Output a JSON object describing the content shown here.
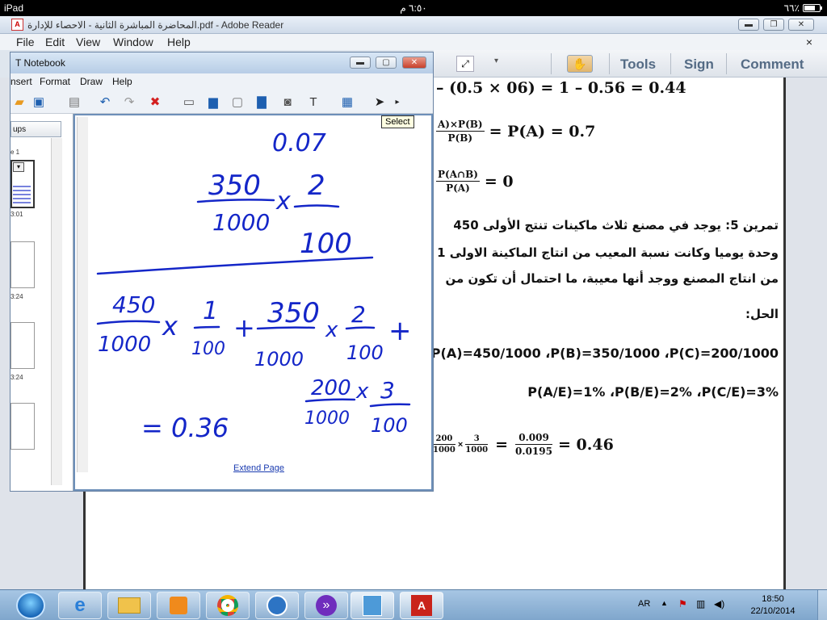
{
  "ipad_status": {
    "device": "iPad",
    "time": "٦:٥٠ م",
    "battery": "٦٦٪"
  },
  "reader": {
    "window_title": "المحاضرة المباشرة الثانية - الاحصاء للإدارة.pdf - Adobe Reader",
    "menu": [
      "File",
      "Edit",
      "View",
      "Window",
      "Help"
    ],
    "close_x": "×",
    "toolbar": {
      "tools": "Tools",
      "sign": "Sign",
      "comment": "Comment"
    }
  },
  "pdf": {
    "line1": "– (0.5 × 06) = 1 – 0.56 = 0.44",
    "line2_frac_num": "A)×P(B)",
    "line2_frac_den": "P(B)",
    "line2_rest": "= P(A) = 0.7",
    "line3_frac_num": "P(A∩B)",
    "line3_frac_den": "P(A)",
    "line3_rest": "= 0",
    "arabic1": "تمرين 5: يوجد في مصنع ثلاث ماكينات تنتج الأولى 450",
    "arabic2": "وحدة يوميا وكانت نسبة المعيب من انتاج الماكينة الاولى 1",
    "arabic3": "من انتاج المصنع ووجد أنها معيبة، ما احتمال أن تكون من",
    "solution": "الحل:",
    "probs": "P(A)=450/1000 ،P(B)=350/1000 ،P(C)=200/1000",
    "cond_probs": "P(A/E)=1%   ،P(B/E)=2% ،P(C/E)=3%",
    "final_f1_num": "200",
    "final_f1_den": "1000",
    "final_x": "×",
    "final_f2_num": "3",
    "final_f2_den": "1000",
    "final_eq1": "=",
    "final_f3_num": "0.009",
    "final_f3_den": "0.0195",
    "final_rest": "= 0.46"
  },
  "notebook": {
    "title": "T Notebook",
    "menu": [
      "nsert",
      "Format",
      "Draw",
      "Help"
    ],
    "tooltip": "Select",
    "groups_button": "ups",
    "thumb_labels": [
      "e 1",
      "3:01",
      "3:24",
      "3:24"
    ],
    "extend_page": "Extend Page",
    "handwriting": {
      "top_value": "0.07",
      "frac_a_num": "350",
      "frac_a_den": "1000",
      "times_a": "x",
      "frac_b_num": "2",
      "frac_b_den": "100",
      "d1_num": "450",
      "d1_den": "1000",
      "d_times1": "x",
      "d2_num": "1",
      "d2_den": "100",
      "plus1": "+",
      "d3_num": "350",
      "d3_den": "1000",
      "d_times2": "x",
      "d4_num": "2",
      "d4_den": "100",
      "plus2": "+",
      "d5_num": "200",
      "d5_den": "1000",
      "d_times3": "x",
      "d6_num": "3",
      "d6_den": "100",
      "result": "= 0.36"
    }
  },
  "taskbar": {
    "lang": "AR",
    "time": "18:50",
    "date": "22/10/2014"
  },
  "colors": {
    "ink": "#1426c8",
    "reader_toolbar_text": "#546b85",
    "taskbar": "#8fb3d6"
  }
}
